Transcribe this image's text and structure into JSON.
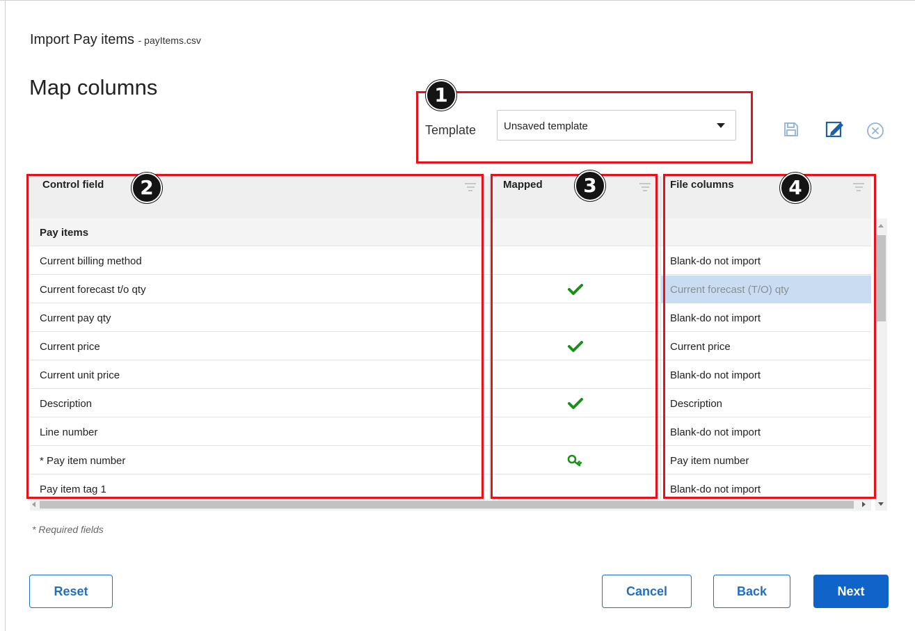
{
  "header": {
    "title": "Import Pay items",
    "file_suffix": "- payItems.csv",
    "page_title": "Map columns"
  },
  "template": {
    "label": "Template",
    "selected": "Unsaved template"
  },
  "toolbar": {
    "icons": [
      "save-icon",
      "edit-template-icon",
      "close-circle-icon"
    ]
  },
  "annotations": [
    "1",
    "2",
    "3",
    "4"
  ],
  "grid": {
    "columns": [
      "Control field",
      "Mapped",
      "File columns"
    ],
    "group_label": "Pay items",
    "rows": [
      {
        "field": "Current billing method",
        "mapped": "",
        "file_column": "Blank-do not import"
      },
      {
        "field": "Current forecast t/o qty",
        "mapped": "check",
        "file_column": "Current forecast (T/O) qty",
        "selected": true
      },
      {
        "field": "Current pay qty",
        "mapped": "",
        "file_column": "Blank-do not import"
      },
      {
        "field": "Current price",
        "mapped": "check",
        "file_column": "Current price"
      },
      {
        "field": "Current unit price",
        "mapped": "",
        "file_column": "Blank-do not import"
      },
      {
        "field": "Description",
        "mapped": "check",
        "file_column": "Description"
      },
      {
        "field": "Line number",
        "mapped": "",
        "file_column": "Blank-do not import"
      },
      {
        "field": "* Pay item number",
        "mapped": "key",
        "file_column": "Pay item number"
      },
      {
        "field": "Pay item tag 1",
        "mapped": "",
        "file_column": "Blank-do not import"
      }
    ]
  },
  "required_note": "* Required fields",
  "buttons": {
    "reset": "Reset",
    "cancel": "Cancel",
    "back": "Back",
    "next": "Next"
  },
  "colors": {
    "annotation_red": "#e8101b",
    "primary_blue": "#1064c9",
    "check_green": "#1a8f1a",
    "selected_row": "#c9dcf1"
  }
}
